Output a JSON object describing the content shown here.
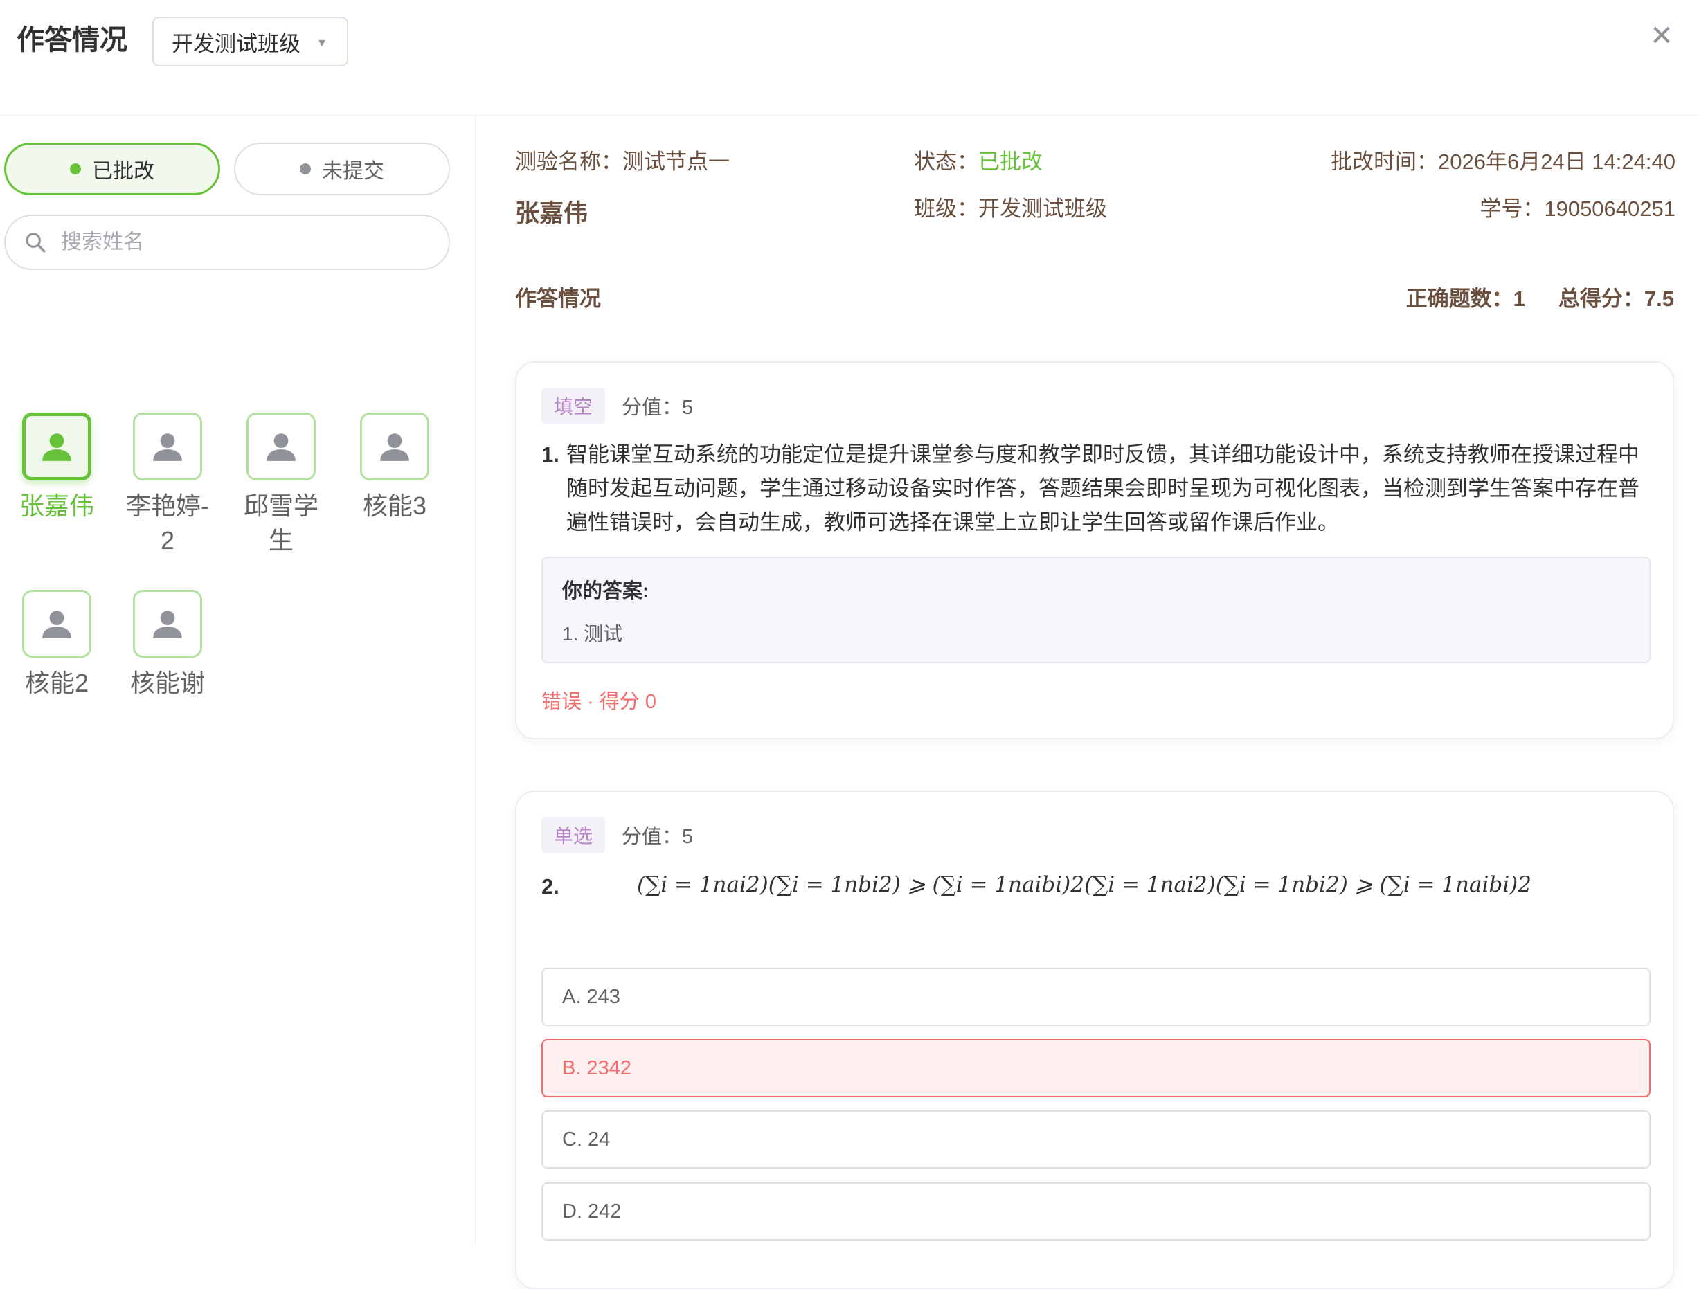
{
  "header": {
    "title": "作答情况",
    "class_select": {
      "value": "开发测试班级"
    }
  },
  "sidebar": {
    "filters": [
      {
        "label": "已批改",
        "active": true
      },
      {
        "label": "未提交",
        "active": false
      }
    ],
    "search": {
      "placeholder": "搜索姓名",
      "value": ""
    },
    "students": [
      {
        "name": "张嘉伟",
        "active": true
      },
      {
        "name": "李艳婷-2",
        "active": false
      },
      {
        "name": "邱雪学生",
        "active": false
      },
      {
        "name": "核能3",
        "active": false
      },
      {
        "name": "核能2",
        "active": false
      },
      {
        "name": "核能谢",
        "active": false
      }
    ]
  },
  "detail": {
    "quiz_name_label": "测验名称：",
    "quiz_name": "测试节点一",
    "status_label": "状态：",
    "status": "已批改",
    "graded_time_label": "批改时间：",
    "graded_time": "2026年6月24日 14:24:40",
    "student_name": "张嘉伟",
    "class_label": "班级：",
    "class_name": "开发测试班级",
    "student_id_label": "学号：",
    "student_id": "19050640251",
    "section_title": "作答情况",
    "correct_count_label": "正确题数：",
    "correct_count": "1",
    "total_score_label": "总得分：",
    "total_score": "7.5"
  },
  "questions": [
    {
      "type": "填空",
      "score": "分值：5",
      "number": "1.",
      "stem": "智能课堂互动系统的功能定位是提升课堂参与度和教学即时反馈，其详细功能设计中，系统支持教师在授课过程中随时发起互动问题，学生通过移动设备实时作答，答题结果会即时呈现为可视化图表，当检测到学生答案中存在普遍性错误时，会自动生成，教师可选择在课堂上立即让学生回答或留作课后作业。",
      "answer_label": "你的答案:",
      "answer": "1.  测试",
      "result": "错误 · 得分 0"
    },
    {
      "type": "单选",
      "score": "分值：5",
      "number": "2.",
      "formula": "(∑i = 1nai2)(∑i = 1nbi2) ⩾ (∑i = 1naibi)2(∑i = 1nai2)(∑i = 1nbi2) ⩾ (∑i = 1naibi)2",
      "options": [
        {
          "label": "A. 243",
          "state": "normal"
        },
        {
          "label": "B. 2342",
          "state": "wrong"
        },
        {
          "label": "C. 24",
          "state": "normal"
        },
        {
          "label": "D. 242",
          "state": "normal"
        }
      ]
    }
  ],
  "colors": {
    "accent_green": "#67c23a",
    "error_red": "#f56c6c",
    "label_brown": "#6b5040",
    "tag_purple": "#b484c4"
  }
}
